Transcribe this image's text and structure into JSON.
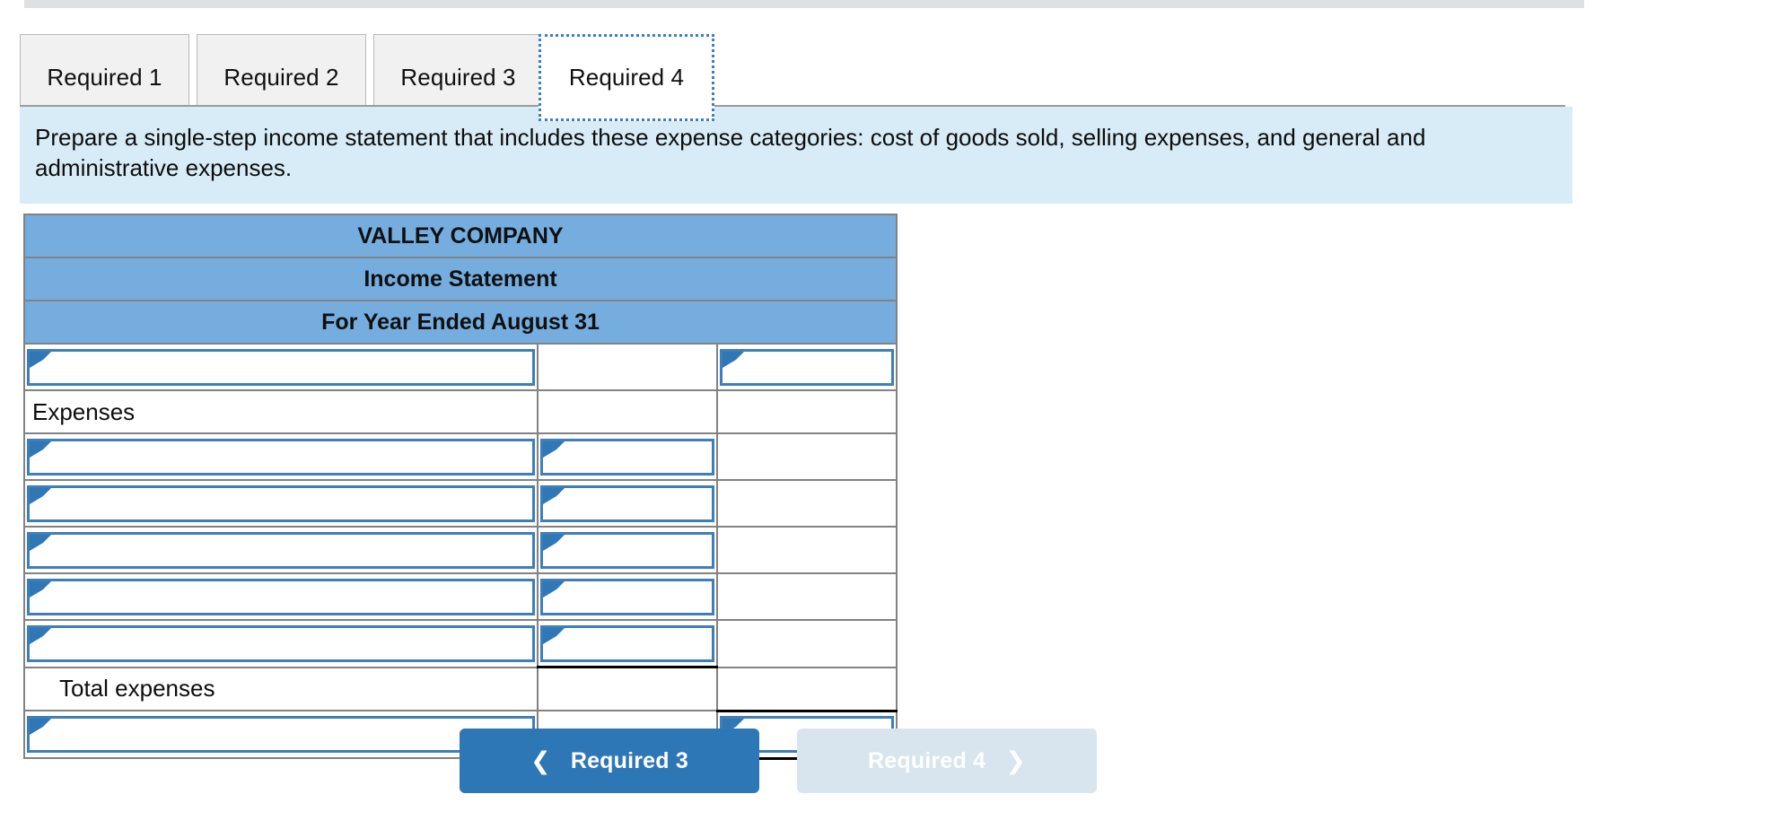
{
  "tabs": [
    {
      "label": "Required 1",
      "active": false
    },
    {
      "label": "Required 2",
      "active": false
    },
    {
      "label": "Required 3",
      "active": false
    },
    {
      "label": "Required 4",
      "active": true
    }
  ],
  "instruction": {
    "text": "Prepare a single-step income statement that includes these expense categories: cost of goods sold, selling expenses, and general and administrative expenses."
  },
  "statement": {
    "header_lines": [
      "VALLEY COMPANY",
      "Income Statement",
      "For Year Ended August 31"
    ],
    "columns": [
      "description",
      "subtotal",
      "total"
    ],
    "rows": [
      {
        "kind": "input-row",
        "description": {
          "type": "input",
          "value": "",
          "placeholder": ""
        },
        "subtotal": {
          "type": "blank"
        },
        "total": {
          "type": "input",
          "value": "",
          "placeholder": ""
        }
      },
      {
        "kind": "label-row",
        "description": {
          "type": "label",
          "text": "Expenses",
          "indent": false
        },
        "subtotal": {
          "type": "blank"
        },
        "total": {
          "type": "blank"
        }
      },
      {
        "kind": "input-row",
        "description": {
          "type": "input",
          "value": "",
          "placeholder": ""
        },
        "subtotal": {
          "type": "input",
          "value": "",
          "placeholder": ""
        },
        "total": {
          "type": "blank"
        }
      },
      {
        "kind": "input-row",
        "description": {
          "type": "input",
          "value": "",
          "placeholder": ""
        },
        "subtotal": {
          "type": "input",
          "value": "",
          "placeholder": ""
        },
        "total": {
          "type": "blank"
        }
      },
      {
        "kind": "input-row",
        "description": {
          "type": "input",
          "value": "",
          "placeholder": ""
        },
        "subtotal": {
          "type": "input",
          "value": "",
          "placeholder": ""
        },
        "total": {
          "type": "blank"
        }
      },
      {
        "kind": "input-row",
        "description": {
          "type": "input",
          "value": "",
          "placeholder": ""
        },
        "subtotal": {
          "type": "input",
          "value": "",
          "placeholder": ""
        },
        "total": {
          "type": "blank"
        }
      },
      {
        "kind": "input-row",
        "description": {
          "type": "input",
          "value": "",
          "placeholder": ""
        },
        "subtotal": {
          "type": "input",
          "value": "",
          "placeholder": ""
        },
        "total": {
          "type": "blank"
        }
      },
      {
        "kind": "label-row",
        "description": {
          "type": "label",
          "text": "Total expenses",
          "indent": true
        },
        "subtotal": {
          "type": "blank",
          "rule": "top"
        },
        "total": {
          "type": "blank"
        }
      },
      {
        "kind": "input-row",
        "description": {
          "type": "input",
          "value": "",
          "placeholder": ""
        },
        "subtotal": {
          "type": "blank"
        },
        "total": {
          "type": "input",
          "value": "",
          "placeholder": "",
          "rule": "top-bottom"
        }
      }
    ]
  },
  "navigation": {
    "prev": {
      "label": "Required 3",
      "icon": "chevron-left-icon",
      "enabled": true
    },
    "next": {
      "label": "Required 4",
      "icon": "chevron-right-icon",
      "enabled": false
    }
  },
  "colors": {
    "header_blue": "#75addf",
    "banner_blue": "#d8ecf8",
    "input_border": "#3d7fb9",
    "marker_blue": "#2f77b5",
    "button_blue": "#2e77b6",
    "button_disabled": "#d8e5ef",
    "grid_grey": "#828282"
  }
}
